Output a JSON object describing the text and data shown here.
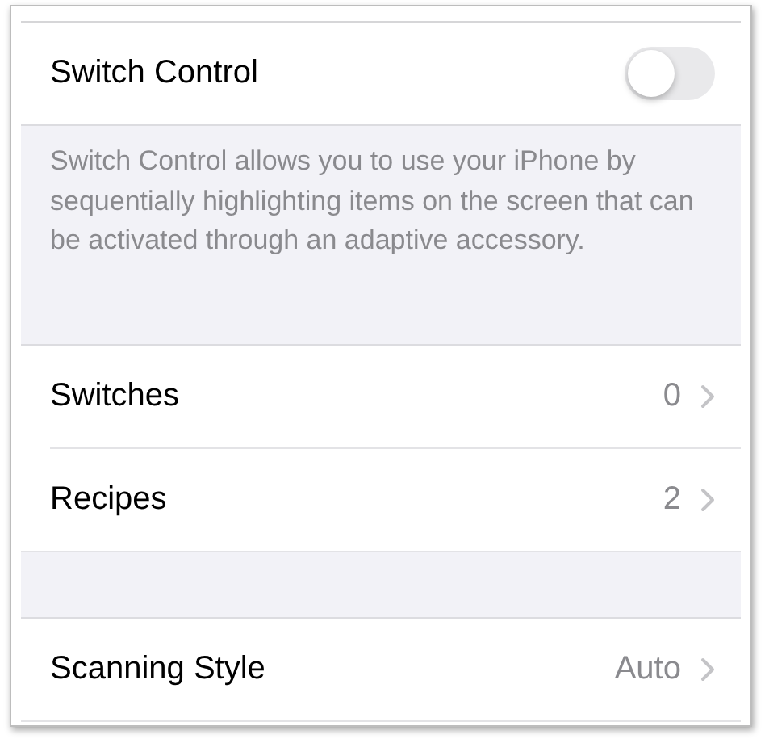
{
  "switch_control": {
    "label": "Switch Control",
    "on": false
  },
  "description": "Switch Control allows you to use your iPhone by sequentially highlighting items on the screen that can be activated through an adaptive accessory.",
  "rows": [
    {
      "label": "Switches",
      "value": "0"
    },
    {
      "label": "Recipes",
      "value": "2"
    }
  ],
  "rows_2": [
    {
      "label": "Scanning Style",
      "value": "Auto"
    }
  ]
}
